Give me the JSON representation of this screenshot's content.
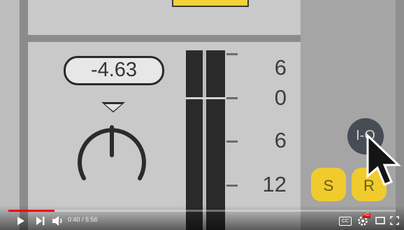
{
  "panel": {
    "value_readout": "-4.63",
    "io_button": "I-O",
    "solo_button": "S",
    "record_button": "R"
  },
  "meter_scale": [
    "6",
    "0",
    "6",
    "12"
  ],
  "player": {
    "time": "0:40 / 5:56",
    "progress_fraction": 0.112,
    "cc_label": "CC",
    "hd_label": "HD"
  },
  "colors": {
    "accent_yellow": "#f0cb2e",
    "progress_red": "#ff0000"
  }
}
